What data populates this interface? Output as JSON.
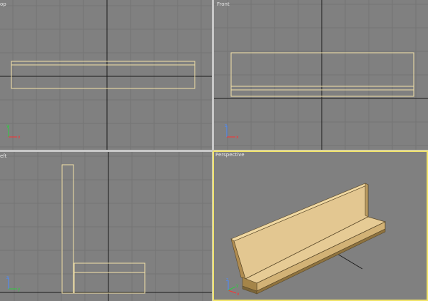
{
  "viewports": {
    "top": {
      "label": "op"
    },
    "front": {
      "label": "Front"
    },
    "left": {
      "label": "eft"
    },
    "perspective": {
      "label": "Perspective"
    }
  },
  "axis_letters": {
    "x": "x",
    "y": "y",
    "z": "z"
  },
  "colors": {
    "viewport_bg": "#808080",
    "grid_line": "#737373",
    "axis_line": "#1a1a1a",
    "object_wire": "#f3e2a8",
    "active_border": "#f0e36a",
    "bench_top": "#e3c791",
    "bench_side": "#c9a96e",
    "bench_edge": "#5b4a2a"
  }
}
